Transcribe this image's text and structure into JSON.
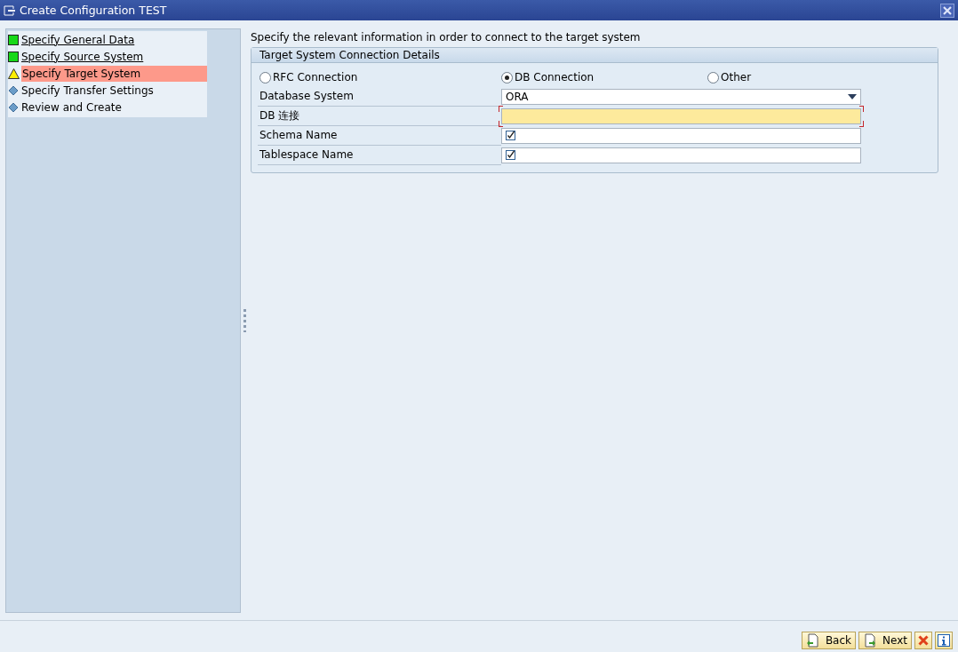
{
  "window": {
    "title": "Create Configuration TEST"
  },
  "steps": [
    {
      "label": "Specify General Data",
      "kind": "done",
      "selected": false
    },
    {
      "label": "Specify Source System",
      "kind": "done",
      "selected": false
    },
    {
      "label": "Specify Target System",
      "kind": "warning",
      "selected": true
    },
    {
      "label": "Specify Transfer Settings",
      "kind": "pending",
      "selected": false
    },
    {
      "label": "Review and Create",
      "kind": "pending",
      "selected": false
    }
  ],
  "instruction": "Specify the relevant information in order to connect to the target system",
  "group": {
    "title": "Target System Connection Details",
    "connection_types": [
      {
        "label": "RFC Connection",
        "selected": false
      },
      {
        "label": "DB Connection",
        "selected": true
      },
      {
        "label": "Other",
        "selected": false
      }
    ],
    "fields": [
      {
        "label": "Database System",
        "kind": "dropdown",
        "value": "ORA",
        "required": false
      },
      {
        "label": "DB 连接",
        "kind": "text",
        "required": true
      },
      {
        "label": "Schema Name",
        "kind": "checkbox",
        "checked": true,
        "required": false
      },
      {
        "label": "Tablespace Name",
        "kind": "checkbox",
        "checked": true,
        "required": false
      }
    ]
  },
  "buttons": [
    {
      "label": "Back",
      "kind": "back"
    },
    {
      "label": "Next",
      "kind": "next"
    },
    {
      "kind": "cancel"
    },
    {
      "kind": "info"
    }
  ]
}
